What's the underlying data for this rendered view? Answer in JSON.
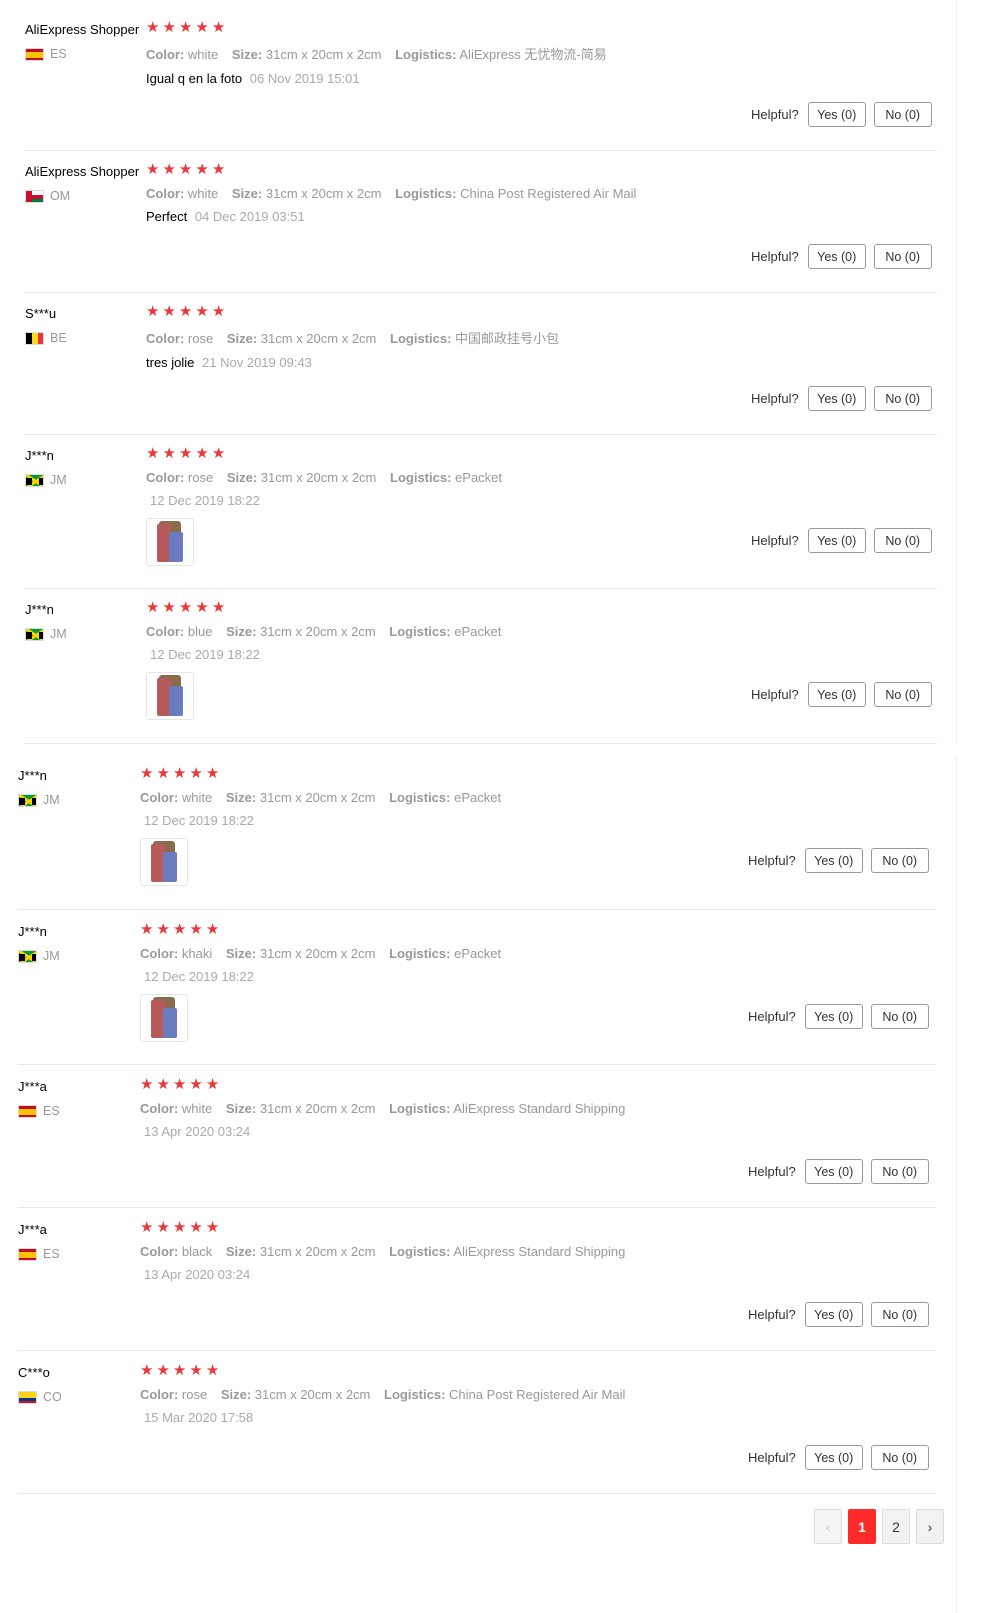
{
  "helpful_label": "Helpful?",
  "reviews": [
    {
      "name": "AliExpress Shopper",
      "country": "ES",
      "color": "white",
      "size": "31cm x 20cm x 2cm",
      "logistics": "AliExpress 无忧物流-简易",
      "text": "Igual q en la foto",
      "date": "06 Nov 2019 15:01",
      "yes": "Yes (0)",
      "no": "No (0)"
    },
    {
      "name": "AliExpress Shopper",
      "country": "OM",
      "color": "white",
      "size": "31cm x 20cm x 2cm",
      "logistics": "China Post Registered Air Mail",
      "text": "Perfect",
      "date": "04 Dec 2019 03:51",
      "yes": "Yes (0)",
      "no": "No (0)"
    },
    {
      "name": "S***u",
      "country": "BE",
      "color": "rose",
      "size": "31cm x 20cm x 2cm",
      "logistics": "中国邮政挂号小包",
      "text": "tres jolie",
      "date": "21 Nov 2019 09:43",
      "yes": "Yes (0)",
      "no": "No (0)"
    },
    {
      "name": "J***n",
      "country": "JM",
      "color": "rose",
      "size": "31cm x 20cm x 2cm",
      "logistics": "ePacket",
      "text": "",
      "date": "12 Dec 2019 18:22",
      "yes": "Yes (0)",
      "no": "No (0)"
    },
    {
      "name": "J***n",
      "country": "JM",
      "color": "blue",
      "size": "31cm x 20cm x 2cm",
      "logistics": "ePacket",
      "text": "",
      "date": "12 Dec 2019 18:22",
      "yes": "Yes (0)",
      "no": "No (0)"
    },
    {
      "name": "J***n",
      "country": "JM",
      "color": "white",
      "size": "31cm x 20cm x 2cm",
      "logistics": "ePacket",
      "text": "",
      "date": "12 Dec 2019 18:22",
      "yes": "Yes (0)",
      "no": "No (0)"
    },
    {
      "name": "J***n",
      "country": "JM",
      "color": "khaki",
      "size": "31cm x 20cm x 2cm",
      "logistics": "ePacket",
      "text": "",
      "date": "12 Dec 2019 18:22",
      "yes": "Yes (0)",
      "no": "No (0)"
    },
    {
      "name": "J***a",
      "country": "ES",
      "color": "white",
      "size": "31cm x 20cm x 2cm",
      "logistics": "AliExpress Standard Shipping",
      "text": "",
      "date": "13 Apr 2020 03:24",
      "yes": "Yes (0)",
      "no": "No (0)"
    },
    {
      "name": "J***a",
      "country": "ES",
      "color": "black",
      "size": "31cm x 20cm x 2cm",
      "logistics": "AliExpress Standard Shipping",
      "text": "",
      "date": "13 Apr 2020 03:24",
      "yes": "Yes (0)",
      "no": "No (0)"
    },
    {
      "name": "C***o",
      "country": "CO",
      "color": "rose",
      "size": "31cm x 20cm x 2cm",
      "logistics": "China Post Registered Air Mail",
      "text": "",
      "date": "15 Mar 2020 17:58",
      "yes": "Yes (0)",
      "no": "No (0)"
    }
  ],
  "labels": {
    "color": "Color:",
    "size": "Size:",
    "logistics": "Logistics:"
  },
  "pagination": {
    "prev": "‹",
    "pages": [
      "1",
      "2"
    ],
    "next": "›",
    "current": "1"
  },
  "colors": {
    "star": "#e83a3a",
    "active_page": "#ff2a2a"
  }
}
